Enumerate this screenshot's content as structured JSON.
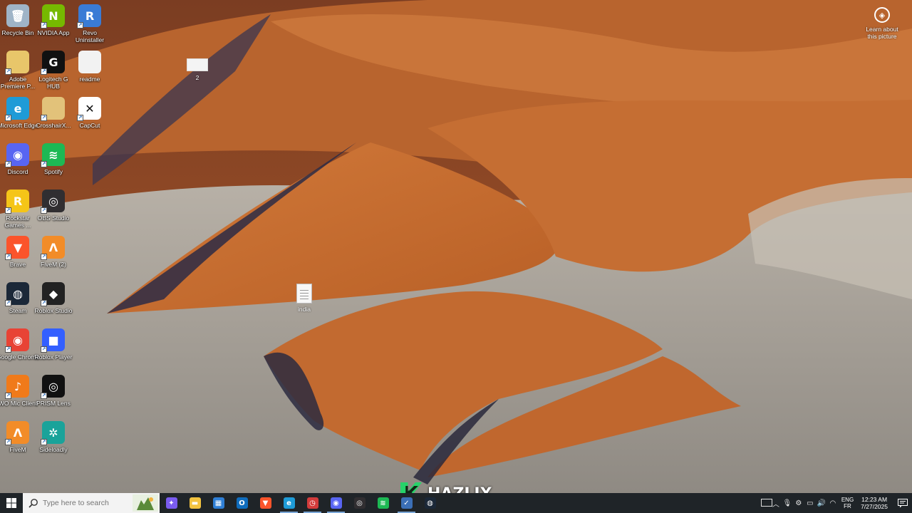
{
  "desktop": {
    "icons": [
      {
        "label": "Recycle Bin",
        "icon": "recycle-bin-icon",
        "color": "#9fb4c7",
        "glyph": "🗑"
      },
      {
        "label": "NVIDIA App",
        "icon": "nvidia-icon",
        "color": "#76b900",
        "glyph": "N"
      },
      {
        "label": "Revo Uninstaller",
        "icon": "revo-uninstaller-icon",
        "color": "#3a7bd5",
        "glyph": "R"
      },
      {
        "label": "Adobe Premiere P...",
        "icon": "folder-icon",
        "color": "#e8c66a",
        "glyph": ""
      },
      {
        "label": "Logitech G HUB",
        "icon": "logitech-g-icon",
        "color": "#111111",
        "glyph": "G"
      },
      {
        "label": "readme",
        "icon": "text-file-icon",
        "color": "#f2f2f2",
        "glyph": ""
      },
      {
        "label": "Microsoft Edge",
        "icon": "edge-icon",
        "color": "#1e9bd7",
        "glyph": "e"
      },
      {
        "label": "CrosshairX...",
        "icon": "crosshairx-icon",
        "color": "#e2c27a",
        "glyph": ""
      },
      {
        "label": "CapCut",
        "icon": "capcut-icon",
        "color": "#ffffff",
        "glyph": "✕"
      },
      {
        "label": "Discord",
        "icon": "discord-icon",
        "color": "#5865f2",
        "glyph": "◉"
      },
      {
        "label": "Spotify",
        "icon": "spotify-icon",
        "color": "#1db954",
        "glyph": "≋"
      },
      {
        "label": "Rockstar Games ...",
        "icon": "rockstar-icon",
        "color": "#f5c518",
        "glyph": "R"
      },
      {
        "label": "OBS Studio",
        "icon": "obs-icon",
        "color": "#302e31",
        "glyph": "◎"
      },
      {
        "label": "Brave",
        "icon": "brave-icon",
        "color": "#fb542b",
        "glyph": "▼"
      },
      {
        "label": "FiveM (2)",
        "icon": "fivem-icon",
        "color": "#f28c28",
        "glyph": "Λ"
      },
      {
        "label": "Steam",
        "icon": "steam-icon",
        "color": "#1b2838",
        "glyph": "◍"
      },
      {
        "label": "Roblox Studio",
        "icon": "roblox-studio-icon",
        "color": "#222222",
        "glyph": "◆"
      },
      {
        "label": "Google Chrome",
        "icon": "chrome-icon",
        "color": "#e84335",
        "glyph": "◉"
      },
      {
        "label": "Roblox Player",
        "icon": "roblox-player-icon",
        "color": "#335fff",
        "glyph": "■"
      },
      {
        "label": "WO Mic Client",
        "icon": "wo-mic-icon",
        "color": "#f07a1a",
        "glyph": "♪"
      },
      {
        "label": "PRISM Lens",
        "icon": "prism-lens-icon",
        "color": "#111111",
        "glyph": "◎"
      },
      {
        "label": "FiveM",
        "icon": "fivem-icon",
        "color": "#f28c28",
        "glyph": "Λ"
      },
      {
        "label": "Sideloadly",
        "icon": "sideloadly-icon",
        "color": "#1aa39a",
        "glyph": "✲"
      }
    ],
    "loose_items": [
      {
        "label": "2",
        "icon": "blank-file-icon"
      },
      {
        "label": "india",
        "icon": "text-file-icon"
      }
    ],
    "learn_about_picture": "Learn about this picture"
  },
  "taskbar": {
    "search_placeholder": "Type here to search",
    "apps": [
      {
        "name": "copilot-taskbar-icon",
        "color": "#7a5cf0",
        "glyph": "✦",
        "running": false
      },
      {
        "name": "file-explorer-taskbar-icon",
        "color": "#f3c340",
        "glyph": "▬",
        "running": false
      },
      {
        "name": "microsoft-store-taskbar-icon",
        "color": "#2f7fd6",
        "glyph": "▦",
        "running": false
      },
      {
        "name": "outlook-taskbar-icon",
        "color": "#0f6cbd",
        "glyph": "O",
        "running": false
      },
      {
        "name": "brave-taskbar-icon",
        "color": "#fb542b",
        "glyph": "▼",
        "running": false
      },
      {
        "name": "edge-taskbar-icon",
        "color": "#1e9bd7",
        "glyph": "e",
        "running": true
      },
      {
        "name": "clock-app-taskbar-icon",
        "color": "#d23b3b",
        "glyph": "◷",
        "running": true
      },
      {
        "name": "discord-taskbar-icon",
        "color": "#5865f2",
        "glyph": "◉",
        "running": true
      },
      {
        "name": "obs-taskbar-icon",
        "color": "#302e31",
        "glyph": "◎",
        "running": false
      },
      {
        "name": "spotify-taskbar-icon",
        "color": "#1db954",
        "glyph": "≋",
        "running": false
      },
      {
        "name": "checklist-taskbar-icon",
        "color": "#3b6fb6",
        "glyph": "✓",
        "running": true
      },
      {
        "name": "steam-taskbar-icon",
        "color": "#1b2838",
        "glyph": "◍",
        "running": false
      }
    ],
    "watermark": {
      "letter": "K",
      "word": "HAZLIX"
    },
    "tray": {
      "language_top": "ENG",
      "language_bottom": "FR",
      "time": "12:23 AM",
      "date": "7/27/2025"
    }
  }
}
